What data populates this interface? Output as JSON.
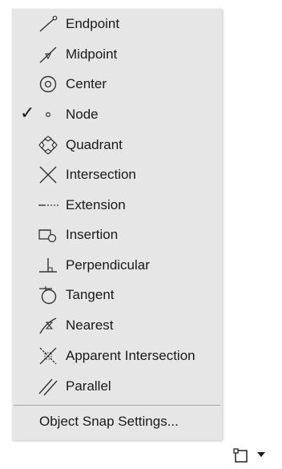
{
  "menu": {
    "items": [
      {
        "label": "Endpoint",
        "icon": "endpoint-icon",
        "checked": false
      },
      {
        "label": "Midpoint",
        "icon": "midpoint-icon",
        "checked": false
      },
      {
        "label": "Center",
        "icon": "center-icon",
        "checked": false
      },
      {
        "label": "Node",
        "icon": "node-icon",
        "checked": true
      },
      {
        "label": "Quadrant",
        "icon": "quadrant-icon",
        "checked": false
      },
      {
        "label": "Intersection",
        "icon": "intersection-icon",
        "checked": false
      },
      {
        "label": "Extension",
        "icon": "extension-icon",
        "checked": false
      },
      {
        "label": "Insertion",
        "icon": "insertion-icon",
        "checked": false
      },
      {
        "label": "Perpendicular",
        "icon": "perpendicular-icon",
        "checked": false
      },
      {
        "label": "Tangent",
        "icon": "tangent-icon",
        "checked": false
      },
      {
        "label": "Nearest",
        "icon": "nearest-icon",
        "checked": false
      },
      {
        "label": "Apparent Intersection",
        "icon": "apparent-intersection-icon",
        "checked": false
      },
      {
        "label": "Parallel",
        "icon": "parallel-icon",
        "checked": false
      }
    ],
    "check_mark": "✓",
    "settings_label": "Object Snap Settings..."
  },
  "status_bar": {
    "object_snap_button_icon": "object-snap-icon",
    "dropdown_icon": "chevron-down-icon"
  }
}
